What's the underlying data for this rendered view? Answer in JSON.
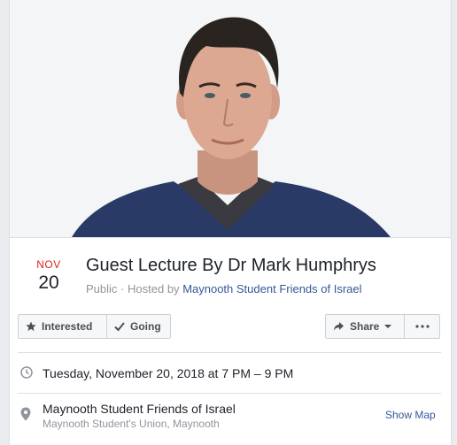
{
  "event": {
    "month": "NOV",
    "day": "20",
    "title": "Guest Lecture By Dr Mark Humphrys",
    "visibility": "Public",
    "hosted_by_prefix": "Hosted by",
    "separator": "·",
    "host_name": "Maynooth Student Friends of Israel",
    "cover_image": "portrait-photo"
  },
  "actions": {
    "interested_label": "Interested",
    "interested_icon": "star-icon",
    "going_label": "Going",
    "going_icon": "check-icon",
    "share_label": "Share",
    "share_icon": "share-arrow-icon",
    "more_icon": "more-dots-icon"
  },
  "details": {
    "datetime": "Tuesday, November 20, 2018 at 7 PM – 9 PM",
    "location_name": "Maynooth Student Friends of Israel",
    "location_address": "Maynooth Student's Union, Maynooth",
    "show_map_label": "Show Map"
  },
  "colors": {
    "month": "#e02020",
    "link": "#365899",
    "muted": "#90949c",
    "background": "#e9ebee"
  }
}
